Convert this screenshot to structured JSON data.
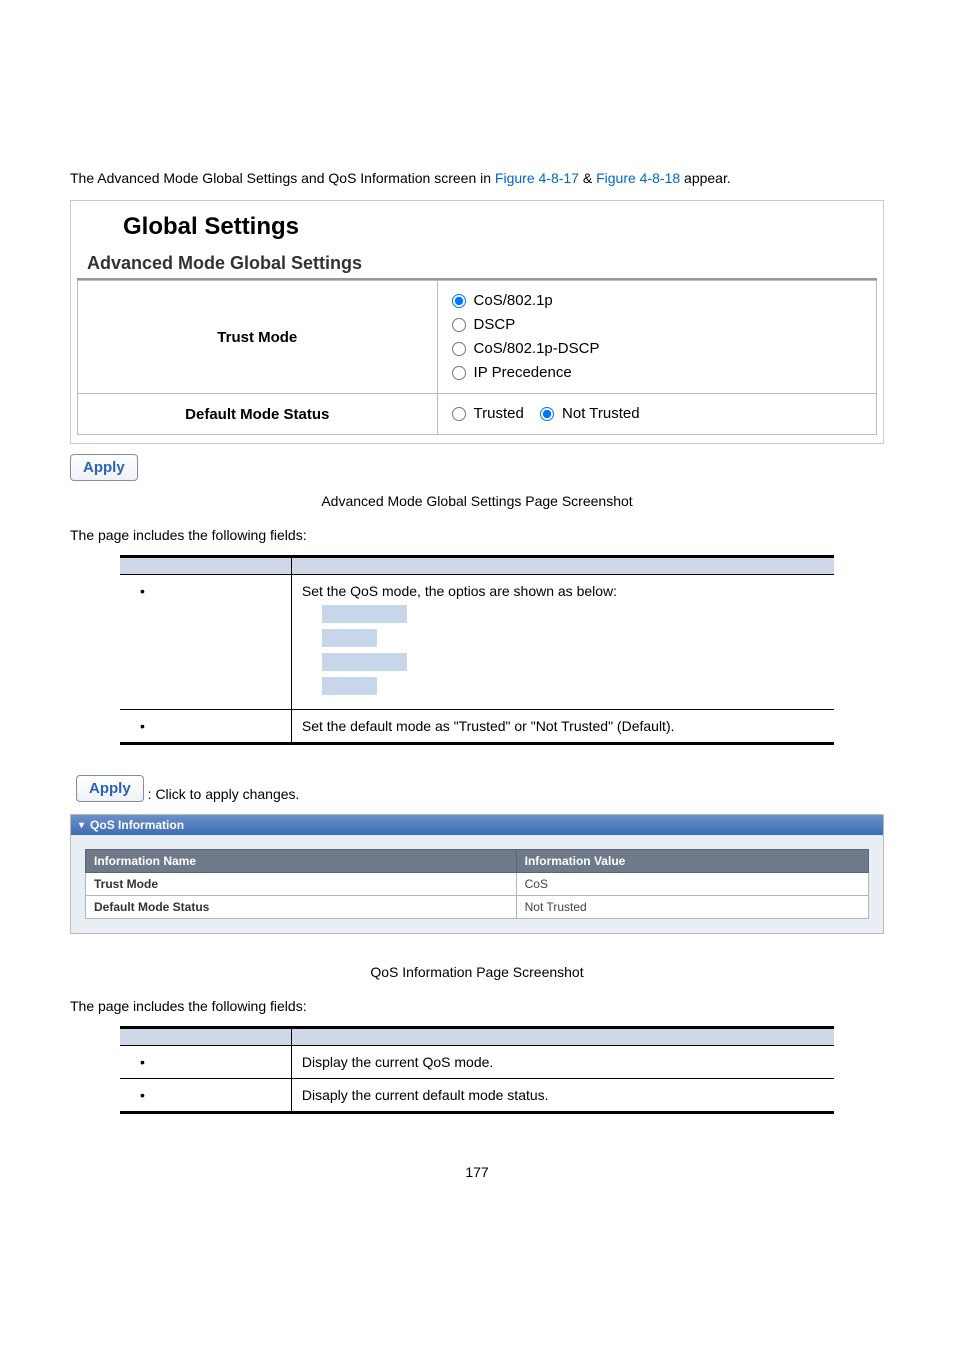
{
  "intro": {
    "prefix": "The Advanced Mode Global Settings and QoS Information screen in ",
    "link1": "Figure 4-8-17",
    "amp": " & ",
    "link2": "Figure 4-8-18",
    "suffix": " appear."
  },
  "panel": {
    "title": "Global Settings",
    "section": "Advanced Mode Global Settings",
    "row1_label": "Trust Mode",
    "trust_options": {
      "o1": "CoS/802.1p",
      "o2": "DSCP",
      "o3": "CoS/802.1p-DSCP",
      "o4": "IP Precedence"
    },
    "row2_label": "Default Mode Status",
    "default_options": {
      "o1": "Trusted",
      "o2": "Not Trusted"
    },
    "apply": "Apply"
  },
  "caption1": "Advanced Mode Global Settings Page Screenshot",
  "fields_intro": "The page includes the following fields:",
  "obj1": {
    "r1_desc": "Set the QoS mode, the optios are shown as below:",
    "r2_desc": "Set the default mode as \"Trusted\" or \"Not Trusted\" (Default)."
  },
  "apply_inline": {
    "btn": "Apply",
    "text": ": Click to apply changes."
  },
  "qos": {
    "header": "QoS Information",
    "th1": "Information Name",
    "th2": "Information Value",
    "r1_name": "Trust Mode",
    "r1_val": "CoS",
    "r2_name": "Default Mode Status",
    "r2_val": "Not Trusted"
  },
  "caption2": "QoS Information Page Screenshot",
  "obj2": {
    "r1_desc": "Display the current QoS mode.",
    "r2_desc": "Disaply the current default mode status."
  },
  "page_number": "177"
}
